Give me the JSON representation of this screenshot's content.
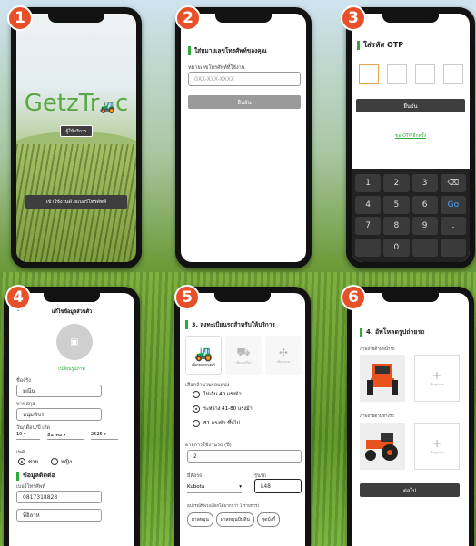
{
  "steps": [
    "1",
    "2",
    "3",
    "4",
    "5",
    "6"
  ],
  "screen1": {
    "logo_a": "GetzTr",
    "logo_b": "c",
    "provider_button": "ผู้ให้บริการ",
    "login_button": "เข้าใช้งานด้วยเบอร์โทรศัพท์"
  },
  "screen2": {
    "title": "ใส่หมายเลขโทรศัพท์ของคุณ",
    "field_label": "หมายเลขโทรศัพท์ที่ใช้งาน",
    "placeholder": "0XX-XXX-XXXX",
    "confirm_button": "ยืนยัน"
  },
  "screen3": {
    "title": "ใส่รหัส OTP",
    "confirm_button": "ยืนยัน",
    "resend_link": "ขอ OTP อีกครั้ง",
    "keys": [
      "1",
      "2",
      "3",
      "⌫",
      "4",
      "5",
      "6",
      "Go",
      "7",
      "8",
      "9",
      ".",
      "",
      "0",
      "",
      ""
    ]
  },
  "screen4": {
    "back": "←",
    "header": "แก้ไขข้อมูลส่วนตัว",
    "upload_photo": "เปลี่ยนรูปภาพ",
    "firstname_label": "ชื่อจริง",
    "firstname_value": "มณีน",
    "lastname_label": "นามสกุล",
    "lastname_value": "หนุ่มพัชร",
    "dob_label": "วัน/เดือน/ปี เกิด",
    "dob_day": "10",
    "dob_month": "มีนาคม",
    "dob_year": "2525",
    "gender_label": "เพศ",
    "gender_male": "ชาย",
    "gender_female": "หญิง",
    "contact_title": "ข้อมูลติดต่อ",
    "phone_label": "เบอร์โทรศัพท์",
    "phone_value": "0817318828",
    "address_value": "ที่อิลาห"
  },
  "screen5": {
    "title": "3. ลงทะเบียนรถสำหรับให้บริการ",
    "vehicles": [
      "เพิ่มรถแทรกเตอร์",
      "เพิ่มรถเกี่ยว",
      "เพิ่มโดรน"
    ],
    "rounds_label": "เลือกจำนวนรอบแบ่ง",
    "option1": "ไม่เกิน 40 แรงม้า",
    "option2": "ระหว่าง 41-80 แรงม้า",
    "option3": "81 แรงม้า ขึ้นไป",
    "age_label": "อายุการใช้งานรถ (ปี)",
    "age_value": "2",
    "brand_label": "ยี่ห้อรถ",
    "brand_value": "Kubota",
    "model_label": "รุ่นรถ",
    "model_value": "L48",
    "equipment_label": "อุปกรณ์ที่พ่วงเลือกได้มากกว่า 1 รายการ)",
    "equipment": [
      "ผาลหมุน",
      "ผาลหมุนปั่นดิน",
      "ชุดบุ้งกี๋"
    ]
  },
  "screen6": {
    "title": "4. อัพโหลดรูปถ่ายรถ",
    "front_label": "ภาพถ่ายด้านหน้ารถ",
    "side_label": "ภาพถ่ายด้านข้างรถ",
    "add_photo": "เพิ่มรูปถ่าย",
    "next_button": "ต่อไป"
  },
  "colors": {
    "accent_green": "#2eaa3c",
    "step_orange": "#e8502a",
    "tractor_orange": "#e8521e",
    "dark_button": "#3e3e3e"
  }
}
